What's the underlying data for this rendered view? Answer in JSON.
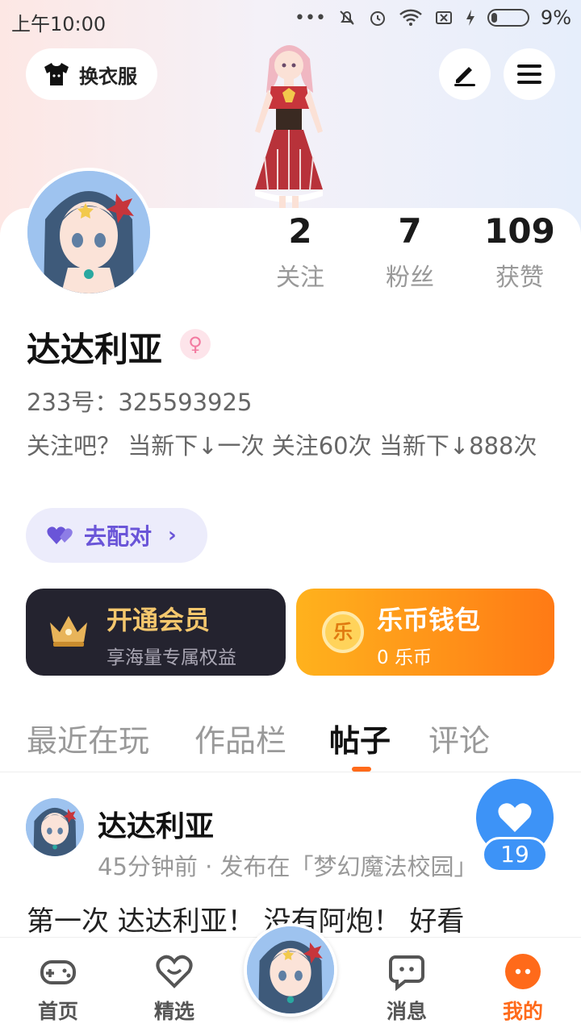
{
  "status_bar": {
    "time": "上午10:00",
    "battery": "9%"
  },
  "header": {
    "outfit_label": "换衣服"
  },
  "profile": {
    "stats": [
      {
        "num": "2",
        "label": "关注"
      },
      {
        "num": "7",
        "label": "粉丝"
      },
      {
        "num": "109",
        "label": "获赞"
      }
    ],
    "name": "达达利亚",
    "gender_icon": "female-icon",
    "uid": "233号：325593925",
    "bio": "关注吧？ 当新下↓一次 关注60次 当新下↓888次",
    "match_label": "去配对"
  },
  "cards": {
    "vip": {
      "title": "开通会员",
      "subtitle": "享海量专属权益"
    },
    "wallet": {
      "title": "乐币钱包",
      "subtitle": "0 乐币",
      "coin_glyph": "乐"
    }
  },
  "tabs": [
    {
      "label": "最近在玩"
    },
    {
      "label": "作品栏"
    },
    {
      "label": "帖子"
    },
    {
      "label": "评论"
    }
  ],
  "post": {
    "author": "达达利亚",
    "meta": "45分钟前 · 发布在「梦幻魔法校园」",
    "text": "第一次 达达利亚！ 没有阿炮！ 好看",
    "likes": "19"
  },
  "nav": [
    {
      "label": "首页",
      "icon": "gamepad-icon"
    },
    {
      "label": "精选",
      "icon": "heart-chat-icon"
    },
    {
      "label": "消息",
      "icon": "message-icon"
    },
    {
      "label": "我的",
      "icon": "me-icon"
    }
  ],
  "colors": {
    "accent": "#ff6a1a",
    "match": "#6a55d8",
    "like": "#3d93f7",
    "vip_bg": "#24232f"
  }
}
